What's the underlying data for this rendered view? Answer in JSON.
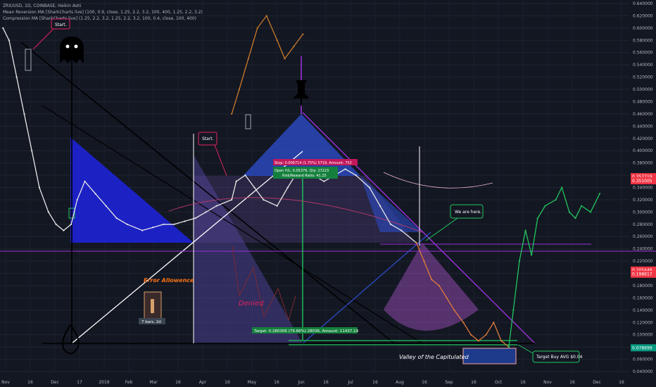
{
  "header": {
    "symbol_line": "ZRX/USD, 1D, COINBASE, Heikin Ashi",
    "indicator1": "Mean Reversion MA [SharkCharts live] (100, 0.9, close, 1.25, 2.2, 3.2, 100, 400, 1.25, 2.2, 3.2)",
    "indicator2": "Compression MA [SharkCharts live] (1.25, 2.2, 3.2, 1.25, 2.2, 3.2, 100, 0.4, close, 100, 400)"
  },
  "notes": {
    "start_top": "Start.",
    "start_mid": "Start.",
    "we_are_here": "We are here.",
    "error_allowance": "Error Allowence",
    "denied": "Denied",
    "valley": "Valley of the Capitulated",
    "target_buy": "Target Buy AVG $0.04",
    "bars_label": "7 bars, 2d",
    "stop_label": "Stop: 0.006714 (1.75%) 5719, Amount: 752",
    "open_label": "Open P/L: 0.05376, Qty: 27223",
    "risk_label": "Risk/Reward Ratio: 41.25",
    "target_label": "Target: 0.280306 (79.66%) 28036, Amount: 11437.19"
  },
  "price_tags": [
    {
      "value": "0.357719",
      "color": "#f23645"
    },
    {
      "value": "0.351005",
      "color": "#f23645"
    },
    {
      "value": "0.205448",
      "color": "#f23645"
    },
    {
      "value": "0.198617",
      "color": "#f23645"
    },
    {
      "value": "0.078699",
      "color": "#089981"
    }
  ],
  "chart_data": {
    "type": "line",
    "title": "",
    "xlabel": "",
    "ylabel": "",
    "x_ticks": [
      "Nov",
      "16",
      "Dec",
      "17",
      "2019",
      "Feb",
      "Mar",
      "16",
      "Apr",
      "16",
      "May",
      "16",
      "Jun",
      "16",
      "Jul",
      "16",
      "Aug",
      "16",
      "Sep",
      "16",
      "Oct",
      "16",
      "Nov",
      "16",
      "Dec",
      "16"
    ],
    "y_ticks": [
      "0.640000",
      "0.620000",
      "0.600000",
      "0.580000",
      "0.560000",
      "0.540000",
      "0.520000",
      "0.500000",
      "0.480000",
      "0.460000",
      "0.440000",
      "0.420000",
      "0.400000",
      "0.380000",
      "0.360000",
      "0.340000",
      "0.320000",
      "0.300000",
      "0.280000",
      "0.260000",
      "0.240000",
      "0.220000",
      "0.200000",
      "0.180000",
      "0.160000",
      "0.140000",
      "0.120000",
      "0.100000",
      "0.080000",
      "0.060000",
      "0.040000"
    ],
    "ylim": [
      0.04,
      0.64
    ],
    "grid": true,
    "series": [
      {
        "color": "#e8e8e8",
        "x": [
          "2018-11-01",
          "2018-11-05",
          "2018-11-10",
          "2018-11-15",
          "2018-11-20",
          "2018-11-25",
          "2018-12-01",
          "2018-12-06",
          "2018-12-11",
          "2018-12-16",
          "2018-12-20",
          "2018-12-25",
          "2019-01-01",
          "2019-01-08",
          "2019-01-15",
          "2019-01-22",
          "2019-02-01",
          "2019-02-08",
          "2019-02-15",
          "2019-02-22",
          "2019-03-01",
          "2019-03-08",
          "2019-03-15",
          "2019-03-22",
          "2019-04-01",
          "2019-04-04",
          "2019-04-10",
          "2019-04-16",
          "2019-04-22",
          "2019-05-01",
          "2019-05-08",
          "2019-05-13",
          "2019-05-18",
          "2019-05-25",
          "2019-06-01",
          "2019-06-08",
          "2019-06-15",
          "2019-06-22",
          "2019-07-01",
          "2019-07-08",
          "2019-07-15",
          "2019-07-22",
          "2019-08-01"
        ],
        "y": [
          0.6,
          0.58,
          0.52,
          0.46,
          0.4,
          0.34,
          0.3,
          0.28,
          0.27,
          0.28,
          0.32,
          0.35,
          0.33,
          0.31,
          0.29,
          0.28,
          0.27,
          0.275,
          0.28,
          0.28,
          0.285,
          0.29,
          0.3,
          0.31,
          0.32,
          0.35,
          0.36,
          0.34,
          0.32,
          0.31,
          0.34,
          0.36,
          0.37,
          0.36,
          0.35,
          0.36,
          0.37,
          0.36,
          0.34,
          0.31,
          0.28,
          0.27,
          0.25
        ]
      },
      {
        "color": "#e07b39",
        "x": [
          "2019-08-01",
          "2019-08-06",
          "2019-08-11",
          "2019-08-16",
          "2019-08-21",
          "2019-08-26",
          "2019-09-01",
          "2019-09-06",
          "2019-09-11",
          "2019-09-16",
          "2019-09-21",
          "2019-09-26",
          "2019-10-01"
        ],
        "y": [
          0.25,
          0.22,
          0.19,
          0.18,
          0.16,
          0.14,
          0.12,
          0.1,
          0.09,
          0.1,
          0.12,
          0.09,
          0.08
        ]
      },
      {
        "color": "#22c55e",
        "x": [
          "2019-10-01",
          "2019-10-04",
          "2019-10-08",
          "2019-10-12",
          "2019-10-16",
          "2019-10-20",
          "2019-10-25",
          "2019-11-01",
          "2019-11-05",
          "2019-11-10",
          "2019-11-14",
          "2019-11-18",
          "2019-11-24",
          "2019-11-30"
        ],
        "y": [
          0.08,
          0.14,
          0.22,
          0.27,
          0.23,
          0.29,
          0.31,
          0.32,
          0.34,
          0.3,
          0.29,
          0.31,
          0.3,
          0.33
        ]
      },
      {
        "color": "#c97a2b",
        "x": [
          "2019-04-01",
          "2019-04-06",
          "2019-04-12",
          "2019-04-18",
          "2019-04-24",
          "2019-05-01",
          "2019-05-06",
          "2019-05-12",
          "2019-05-18"
        ],
        "y": [
          0.46,
          0.5,
          0.55,
          0.6,
          0.62,
          0.58,
          0.55,
          0.57,
          0.59
        ]
      }
    ],
    "x_range": [
      "2018-10-30",
      "2019-12-20"
    ]
  }
}
